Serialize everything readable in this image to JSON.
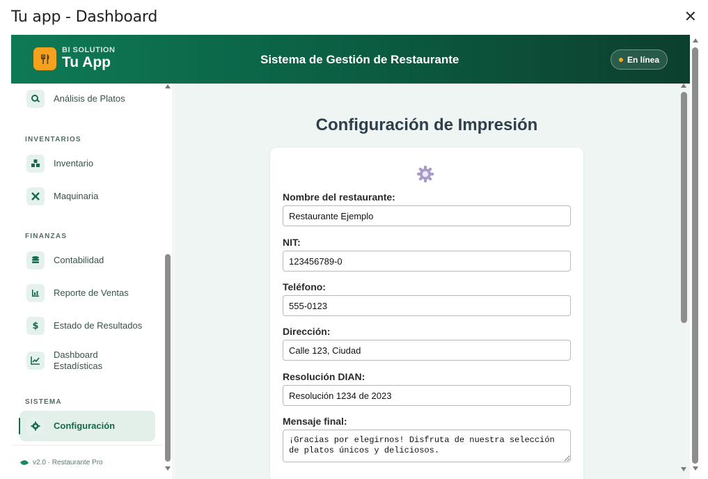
{
  "window": {
    "title": "Tu app - Dashboard",
    "close_symbol": "✕"
  },
  "header": {
    "brand_sub": "BI SOLUTION",
    "brand_main": "Tu App",
    "title": "Sistema de Gestión de Restaurante",
    "status": "En línea"
  },
  "sidebar": {
    "top_item": {
      "label": "Análisis de Platos",
      "icon": "magnifier-chart-icon"
    },
    "sections": [
      {
        "title": "INVENTARIOS",
        "items": [
          {
            "label": "Inventario",
            "icon": "boxes-icon"
          },
          {
            "label": "Maquinaria",
            "icon": "tools-icon"
          }
        ]
      },
      {
        "title": "FINANZAS",
        "items": [
          {
            "label": "Contabilidad",
            "icon": "coins-icon"
          },
          {
            "label": "Reporte de Ventas",
            "icon": "bar-chart-icon"
          },
          {
            "label": "Estado de Resultados",
            "icon": "dollar-icon"
          },
          {
            "label": "Dashboard Estadísticas",
            "icon": "line-chart-icon"
          }
        ]
      },
      {
        "title": "SISTEMA",
        "items": [
          {
            "label": "Configuración",
            "icon": "gear-icon",
            "active": true
          }
        ]
      }
    ],
    "footer": "v2.0 · Restaurante Pro"
  },
  "main": {
    "title": "Configuración de Impresión",
    "fields": [
      {
        "label": "Nombre del restaurante:",
        "value": "Restaurante Ejemplo"
      },
      {
        "label": "NIT:",
        "value": "123456789-0"
      },
      {
        "label": "Teléfono:",
        "value": "555-0123"
      },
      {
        "label": "Dirección:",
        "value": "Calle 123, Ciudad"
      },
      {
        "label": "Resolución DIAN:",
        "value": "Resolución 1234 de 2023"
      }
    ],
    "message": {
      "label": "Mensaje final:",
      "value": "¡Gracias por elegirnos! Disfruta de nuestra selección de platos únicos y deliciosos."
    }
  },
  "colors": {
    "header_start": "#0e7a55",
    "header_end": "#0c3f2d",
    "accent": "#136b4c",
    "logo": "#f4a21d",
    "status_dot": "#f5a623"
  }
}
